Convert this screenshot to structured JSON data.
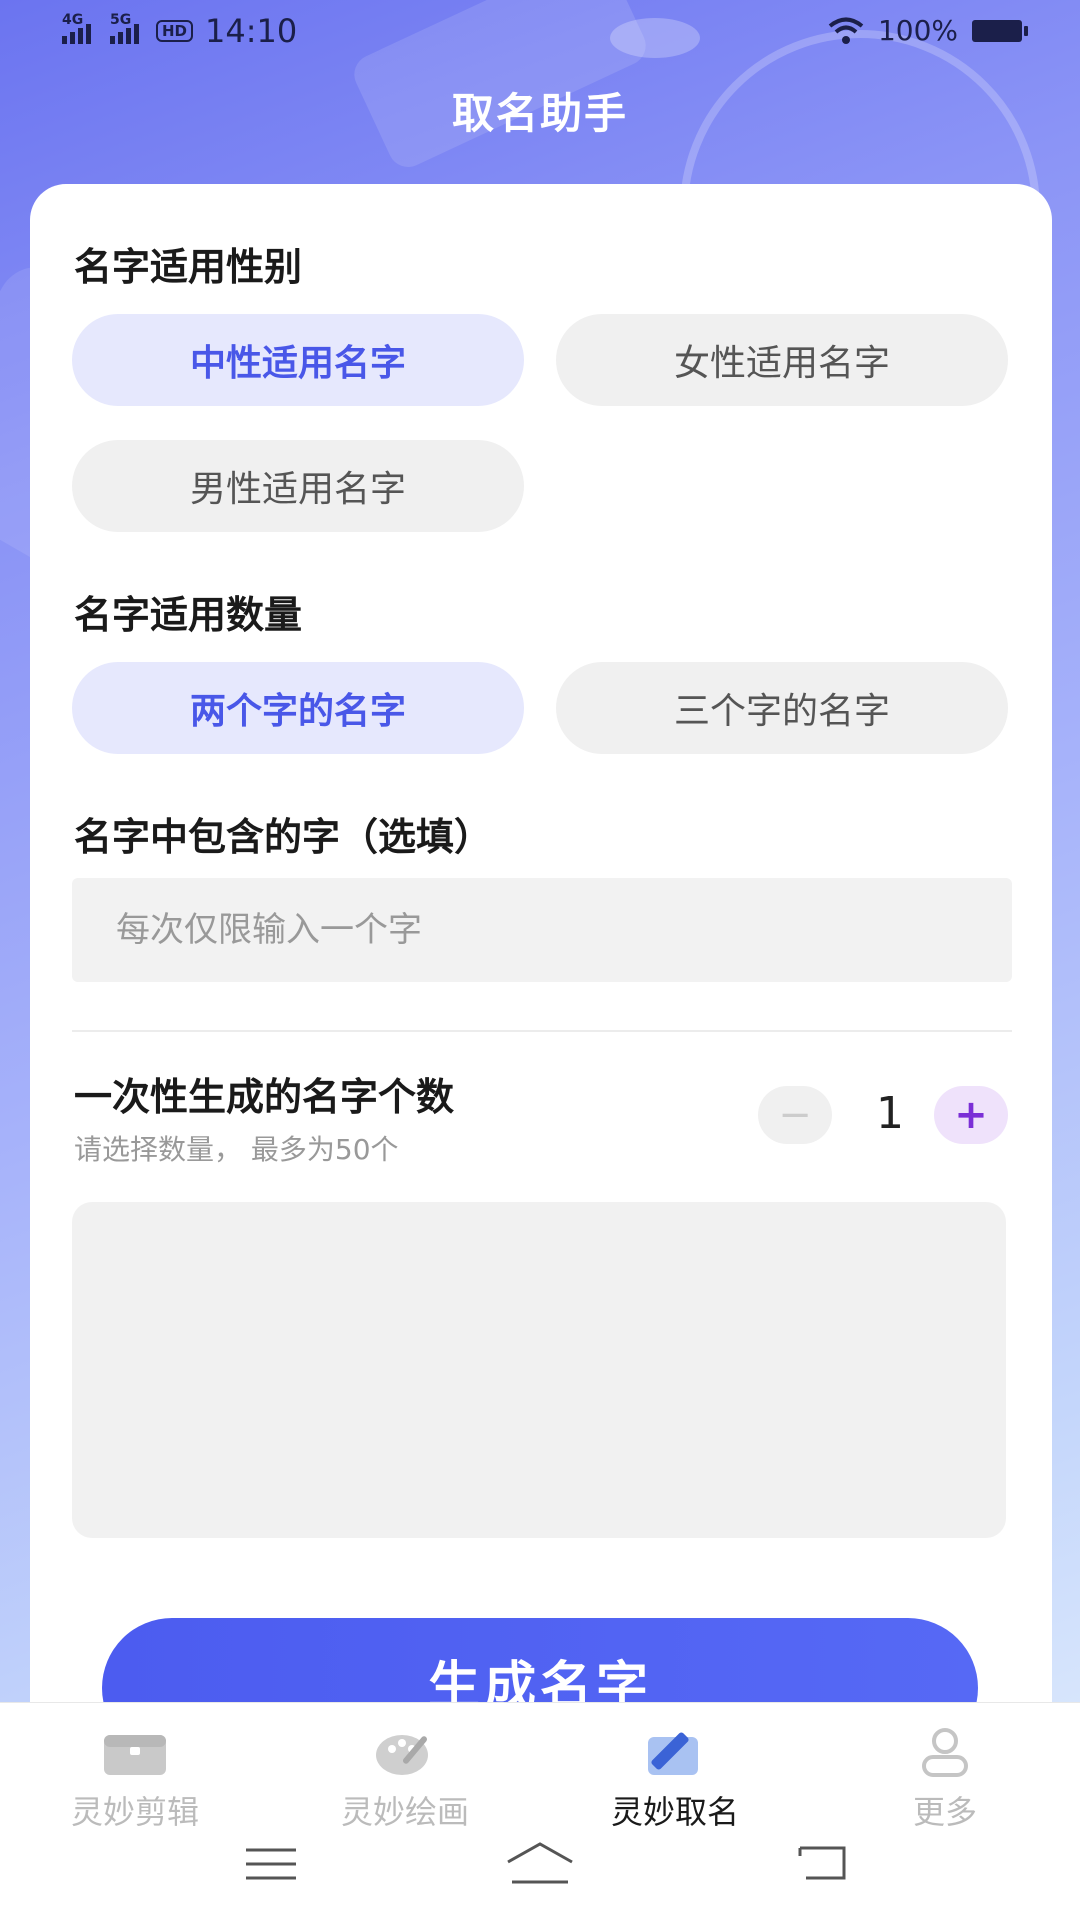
{
  "status_bar": {
    "network1": "4G",
    "network2": "5G",
    "hd": "HD",
    "time": "14:10",
    "battery_text": "100%"
  },
  "header": {
    "title": "取名助手"
  },
  "gender": {
    "title": "名字适用性别",
    "options": [
      "中性适用名字",
      "女性适用名字",
      "男性适用名字"
    ],
    "selected": "中性适用名字"
  },
  "length": {
    "title": "名字适用数量",
    "options": [
      "两个字的名字",
      "三个字的名字"
    ],
    "selected": "两个字的名字"
  },
  "include_char": {
    "title": "名字中包含的字（选填）",
    "placeholder": "每次仅限输入一个字",
    "value": ""
  },
  "count": {
    "title": "一次性生成的名字个数",
    "subtitle": "请选择数量， 最多为50个",
    "minus": "−",
    "plus": "+",
    "value": "1"
  },
  "generate_button": {
    "label": "生成名字"
  },
  "tabbar": {
    "tabs": [
      {
        "label": "灵妙剪辑",
        "icon": "toolbox-icon",
        "active": false
      },
      {
        "label": "灵妙绘画",
        "icon": "palette-icon",
        "active": false
      },
      {
        "label": "灵妙取名",
        "icon": "edit-pen-icon",
        "active": true
      },
      {
        "label": "更多",
        "icon": "user-icon",
        "active": false
      }
    ]
  },
  "colors": {
    "accent": "#4957e8",
    "button": "#5066f2",
    "chip_active_bg": "#e6e8fd",
    "chip_inactive_bg": "#f0f0f0"
  }
}
